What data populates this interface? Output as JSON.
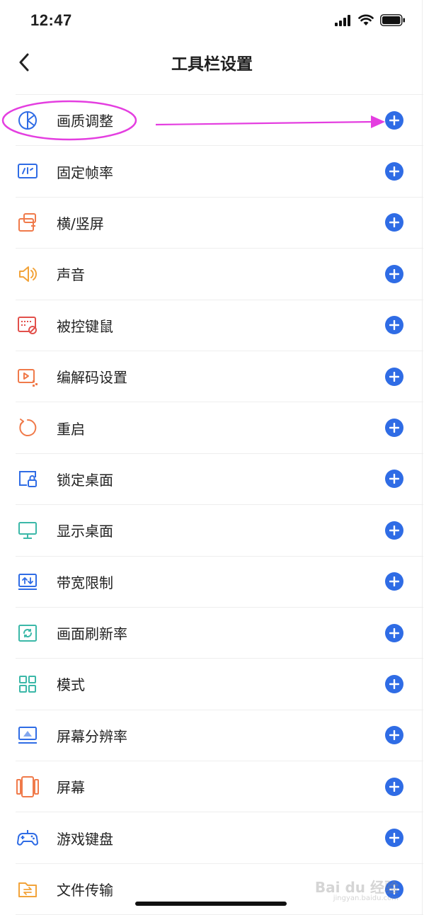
{
  "status_bar": {
    "time": "12:47"
  },
  "nav": {
    "title": "工具栏设置"
  },
  "colors": {
    "accent": "#2f6ce5",
    "annotation": "#e43ee0"
  },
  "items": [
    {
      "label": "画质调整",
      "icon": "quality-icon"
    },
    {
      "label": "固定帧率",
      "icon": "frame-rate-icon"
    },
    {
      "label": "横/竖屏",
      "icon": "rotate-screen-icon"
    },
    {
      "label": "声音",
      "icon": "speaker-icon"
    },
    {
      "label": "被控键鼠",
      "icon": "keyboard-mouse-disabled-icon"
    },
    {
      "label": "编解码设置",
      "icon": "codec-icon"
    },
    {
      "label": "重启",
      "icon": "restart-icon"
    },
    {
      "label": "锁定桌面",
      "icon": "lock-desktop-icon"
    },
    {
      "label": "显示桌面",
      "icon": "monitor-icon"
    },
    {
      "label": "带宽限制",
      "icon": "bandwidth-icon"
    },
    {
      "label": "画面刷新率",
      "icon": "refresh-rate-icon"
    },
    {
      "label": "模式",
      "icon": "grid-mode-icon"
    },
    {
      "label": "屏幕分辨率",
      "icon": "resolution-icon"
    },
    {
      "label": "屏幕",
      "icon": "screen-icon"
    },
    {
      "label": "游戏键盘",
      "icon": "gamepad-icon"
    },
    {
      "label": "文件传输",
      "icon": "file-transfer-icon"
    }
  ],
  "watermark": {
    "brand": "Bai du 经验",
    "url": "jingyan.baidu.com"
  }
}
